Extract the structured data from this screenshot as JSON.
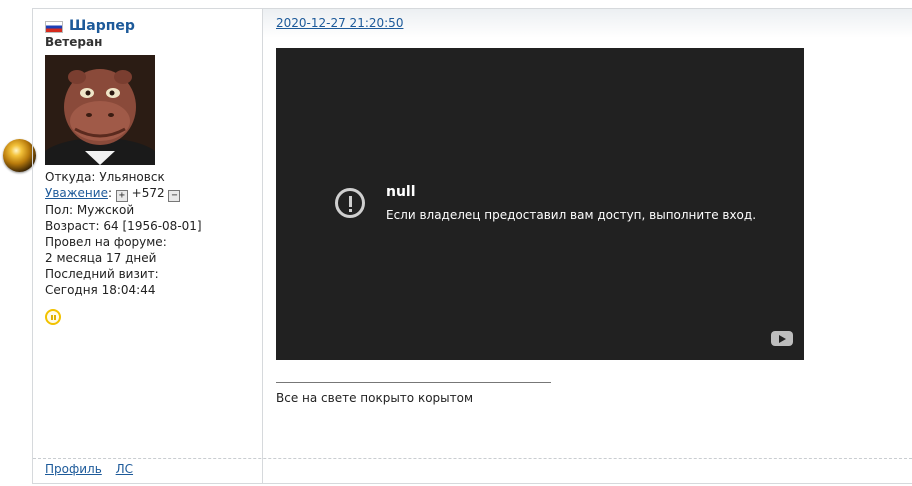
{
  "user": {
    "name": "Шарпер",
    "rank": "Ветеран",
    "from_label": "Откуда:",
    "from": "Ульяновск",
    "respect_label": "Уважение",
    "respect_value": "+572",
    "gender_label": "Пол:",
    "gender": "Мужской",
    "age_label": "Возраст:",
    "age": "64",
    "birthdate": "[1956-08-01]",
    "forum_time_label": "Провел на форуме:",
    "forum_time": "2 месяца 17 дней",
    "last_visit_label": "Последний визит:",
    "last_visit": "Сегодня 18:04:44"
  },
  "post": {
    "date": "2020-12-27 21:20:50",
    "video": {
      "title": "null",
      "message": "Если владелец предоставил вам доступ, выполните вход."
    },
    "signature": "Все на свете покрыто корытом"
  },
  "footer": {
    "profile": "Профиль",
    "pm": "ЛС"
  },
  "icons": {
    "flag": "russia-flag-icon",
    "orb": "gold-orb-icon",
    "status": "pause-status-icon",
    "respect_plus": "plus-icon",
    "respect_minus": "minus-icon",
    "error": "error-icon",
    "youtube": "youtube-icon"
  },
  "colors": {
    "link": "#1d5a9a",
    "video_bg": "#212121"
  }
}
